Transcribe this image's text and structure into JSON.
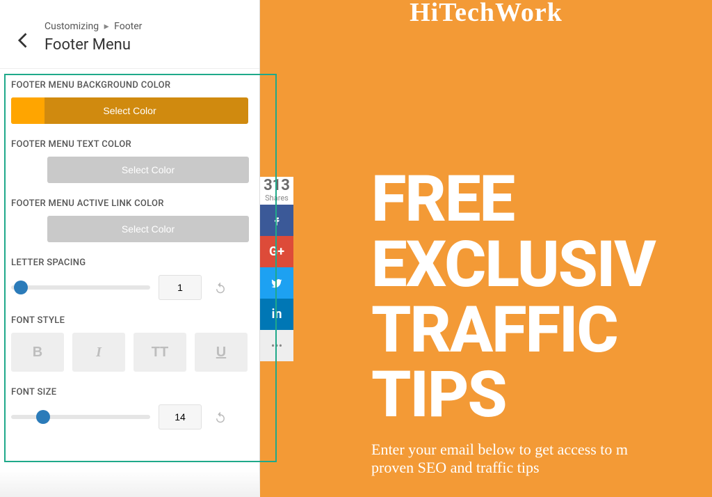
{
  "header": {
    "breadcrumb_root": "Customizing",
    "breadcrumb_leaf": "Footer",
    "title": "Footer Menu"
  },
  "controls": {
    "bg_color": {
      "label": "FOOTER MENU BACKGROUND COLOR",
      "button": "Select Color"
    },
    "text_color": {
      "label": "FOOTER MENU TEXT COLOR",
      "button": "Select Color"
    },
    "active_link_color": {
      "label": "FOOTER MENU ACTIVE LINK COLOR",
      "button": "Select Color"
    },
    "letter_spacing": {
      "label": "LETTER SPACING",
      "value": "1"
    },
    "font_style": {
      "label": "FONT STYLE",
      "bold": "B",
      "italic": "I",
      "transform": "TT",
      "underline": "U"
    },
    "font_size": {
      "label": "FONT SIZE",
      "value": "14"
    }
  },
  "shares": {
    "count": "313",
    "label": "Shares",
    "gplus": "G+",
    "linkedin": "in",
    "more": "•••"
  },
  "preview": {
    "logo": "HiTechWork",
    "headline_l1": "FREE",
    "headline_l2": "EXCLUSIV",
    "headline_l3": "TRAFFIC",
    "headline_l4": "TIPS",
    "subtext": "Enter your email below to get access to m",
    "subtext2": "proven SEO and traffic tips"
  }
}
